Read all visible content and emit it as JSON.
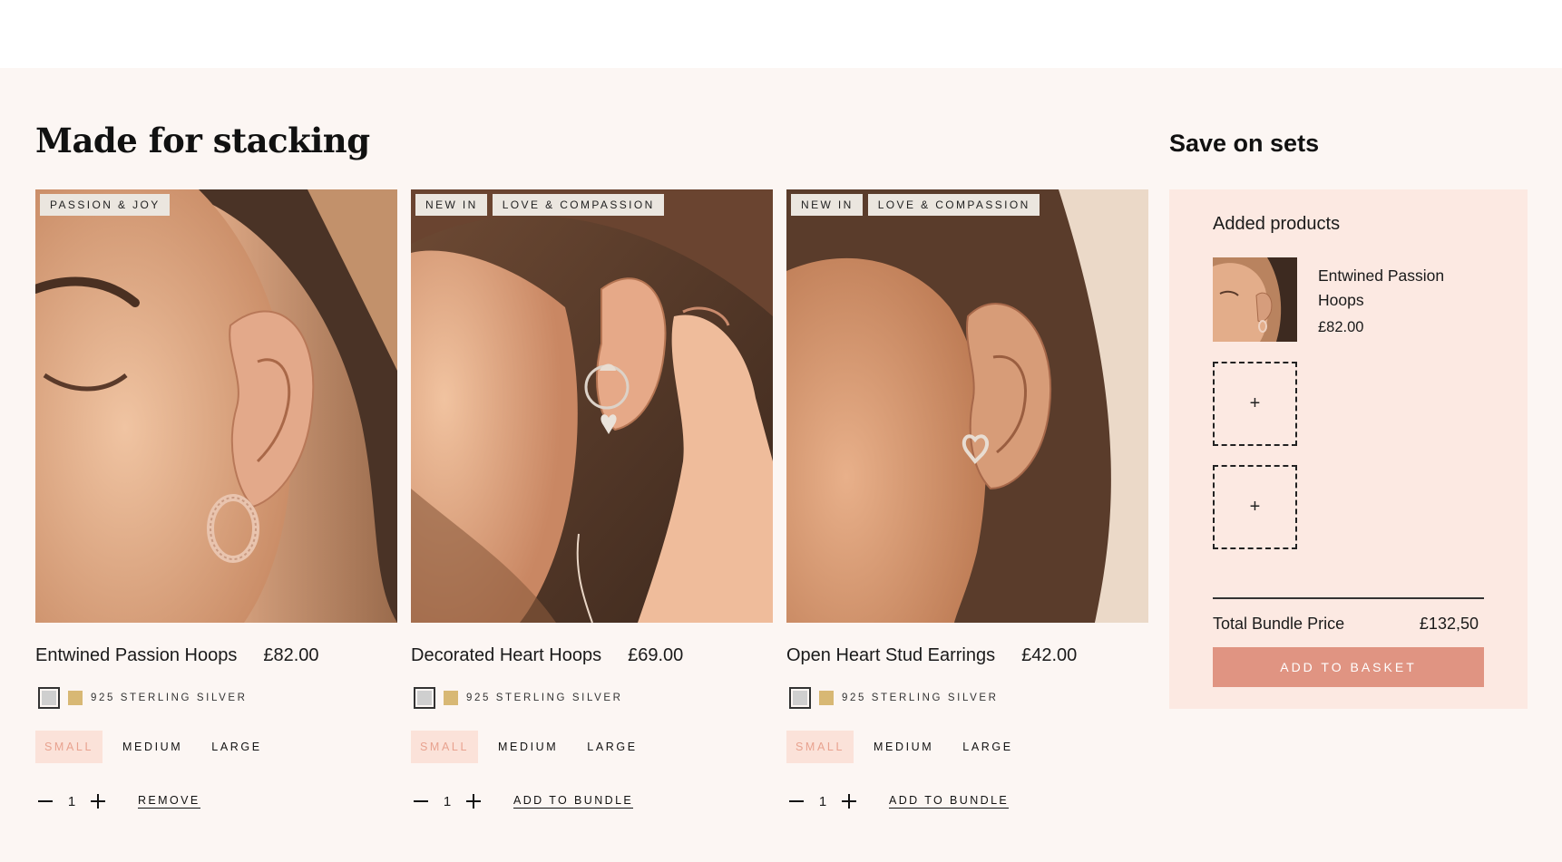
{
  "section": {
    "heading": "Made for stacking"
  },
  "products": [
    {
      "tags": [
        "PASSION & JOY"
      ],
      "name": "Entwined Passion Hoops",
      "price": "£82.00",
      "variant_label": "925 STERLING SILVER",
      "sizes": [
        "SMALL",
        "MEDIUM",
        "LARGE"
      ],
      "selected_size": "SMALL",
      "quantity": "1",
      "action_label": "REMOVE"
    },
    {
      "tags": [
        "NEW IN",
        "LOVE & COMPASSION"
      ],
      "name": "Decorated Heart Hoops",
      "price": "£69.00",
      "variant_label": "925 STERLING SILVER",
      "sizes": [
        "SMALL",
        "MEDIUM",
        "LARGE"
      ],
      "selected_size": "SMALL",
      "quantity": "1",
      "action_label": "ADD TO BUNDLE"
    },
    {
      "tags": [
        "NEW IN",
        "LOVE & COMPASSION"
      ],
      "name": "Open Heart Stud Earrings",
      "price": "£42.00",
      "variant_label": "925 STERLING SILVER",
      "sizes": [
        "SMALL",
        "MEDIUM",
        "LARGE"
      ],
      "selected_size": "SMALL",
      "quantity": "1",
      "action_label": "ADD TO BUNDLE"
    }
  ],
  "bundle": {
    "title": "Save on sets",
    "added_title": "Added products",
    "added_item": {
      "name": "Entwined Passion Hoops",
      "price": "£82.00"
    },
    "empty_slot_symbol": "+",
    "total_label": "Total Bundle Price",
    "total_value": "£132,50",
    "button_label": "ADD TO BASKET"
  },
  "colors": {
    "section_bg": "#fcf6f3",
    "panel_bg": "#fce9e2",
    "accent": "#e09482",
    "selected_size_bg": "#fbe2d9",
    "selected_size_text": "#e8a28f",
    "gold_swatch": "#d8b874",
    "silver_swatch": "#cfcfcf"
  },
  "icons": {
    "qty_decrease": "minus-icon",
    "qty_increase": "plus-icon",
    "slot_add": "plus-icon"
  }
}
